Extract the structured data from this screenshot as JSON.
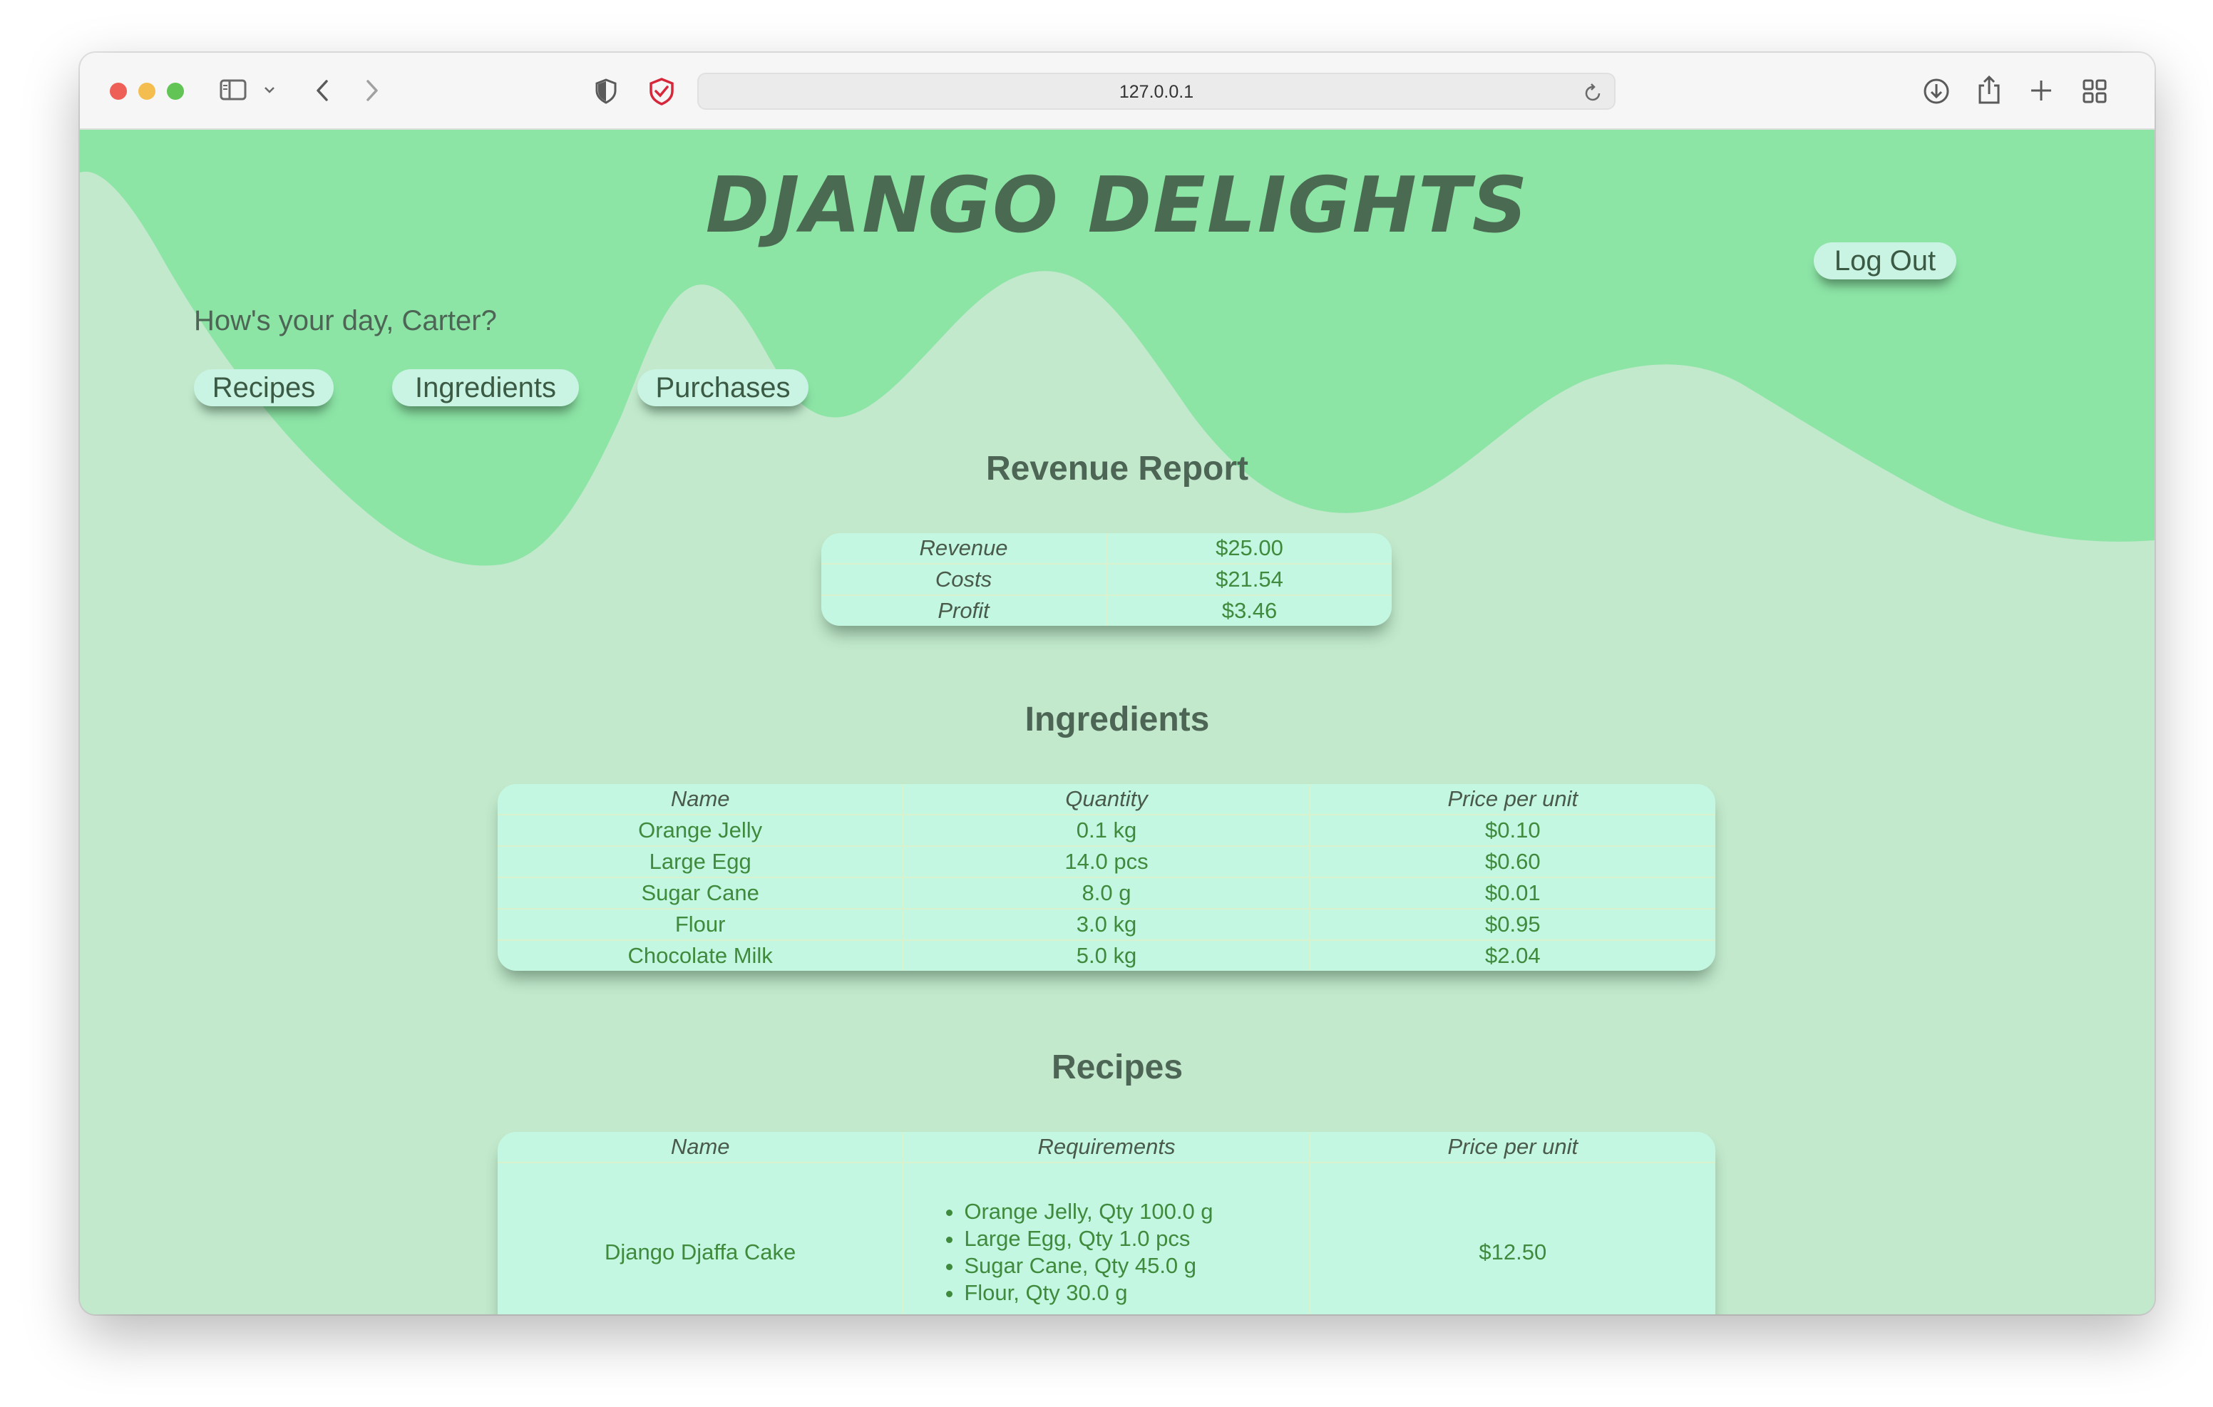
{
  "browser": {
    "url": "127.0.0.1"
  },
  "site": {
    "brand": "DJANGO DELIGHTS",
    "logout_label": "Log Out",
    "greeting": "How's your day, Carter?",
    "nav": [
      {
        "label": "Recipes"
      },
      {
        "label": "Ingredients"
      },
      {
        "label": "Purchases"
      }
    ]
  },
  "revenue_report": {
    "title": "Revenue Report",
    "rows": [
      {
        "label": "Revenue",
        "value": "$25.00"
      },
      {
        "label": "Costs",
        "value": "$21.54"
      },
      {
        "label": "Profit",
        "value": "$3.46"
      }
    ]
  },
  "ingredients": {
    "title": "Ingredients",
    "headers": [
      "Name",
      "Quantity",
      "Price per unit"
    ],
    "rows": [
      {
        "name": "Orange Jelly",
        "quantity": "0.1 kg",
        "price": "$0.10"
      },
      {
        "name": "Large Egg",
        "quantity": "14.0 pcs",
        "price": "$0.60"
      },
      {
        "name": "Sugar Cane",
        "quantity": "8.0 g",
        "price": "$0.01"
      },
      {
        "name": "Flour",
        "quantity": "3.0 kg",
        "price": "$0.95"
      },
      {
        "name": "Chocolate Milk",
        "quantity": "5.0 kg",
        "price": "$2.04"
      }
    ]
  },
  "recipes": {
    "title": "Recipes",
    "headers": [
      "Name",
      "Requirements",
      "Price per unit"
    ],
    "rows": [
      {
        "name": "Django Djaffa Cake",
        "requirements": [
          "Orange Jelly, Qty 100.0 g",
          "Large Egg, Qty 1.0 pcs",
          "Sugar Cane, Qty 45.0 g",
          "Flour, Qty 30.0 g"
        ],
        "price": "$12.50"
      }
    ]
  },
  "colors": {
    "wave_dark": "#8ce4a5",
    "wave_light": "#c2e9cc",
    "heading": "#4a6b52",
    "cell_text": "#3f8a3c",
    "table_bg": "#c3f7e2"
  }
}
